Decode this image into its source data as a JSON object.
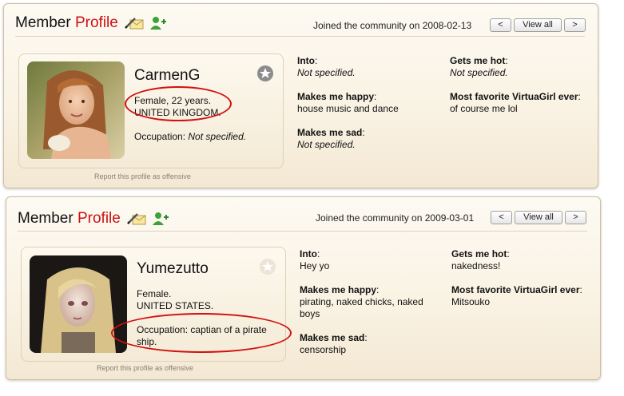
{
  "header": {
    "title_word1": "Member",
    "title_word2": "Profile",
    "view_all_label": "View all",
    "prev_label": "<",
    "next_label": ">",
    "report_label": "Report this profile as offensive"
  },
  "labels": {
    "occupation": "Occupation:",
    "into": "Into",
    "gets_me_hot": "Gets me hot",
    "makes_me_happy": "Makes me happy",
    "favorite_girl": "Most favorite VirtuaGirl ever",
    "makes_me_sad": "Makes me sad"
  },
  "colors": {
    "accent": "#cc1111",
    "highlight_ellipse": "#d21010"
  },
  "icons": [
    "pencil-envelope-icon",
    "add-friend-icon",
    "favorite-star-icon"
  ],
  "profiles": [
    {
      "joined": "Joined the community on 2008-02-13",
      "username": "CarmenG",
      "gender_age": "Female, 22 years.",
      "country": "UNITED KINGDOM.",
      "occupation_value": "Not specified.",
      "into": "Not specified.",
      "gets_me_hot": "Not specified.",
      "makes_me_happy": "house music and dance",
      "favorite_girl": "of course me lol",
      "makes_me_sad": "Not specified."
    },
    {
      "joined": "Joined the community on 2009-03-01",
      "username": "Yumezutto",
      "gender_age": "Female.",
      "country": "UNITED STATES.",
      "occupation_value": "captian of a pirate ship.",
      "into": "Hey yo",
      "gets_me_hot": "nakedness!",
      "makes_me_happy": "pirating, naked chicks, naked boys",
      "favorite_girl": "Mitsouko",
      "makes_me_sad": "censorship"
    }
  ]
}
